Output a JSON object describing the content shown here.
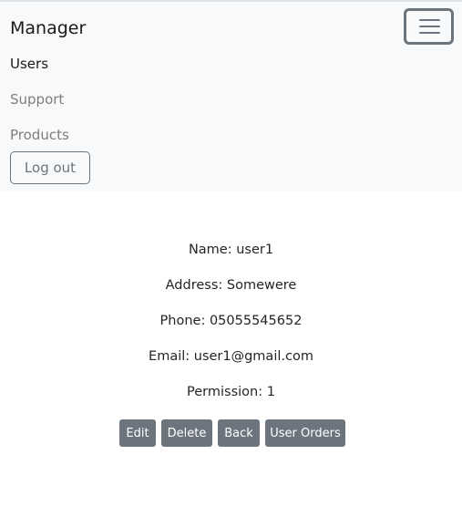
{
  "navbar": {
    "brand": "Manager",
    "items": [
      {
        "label": "Users",
        "active": true
      },
      {
        "label": "Support",
        "active": false
      },
      {
        "label": "Products",
        "active": false
      }
    ],
    "logout_label": "Log out",
    "toggler_icon": "hamburger-icon"
  },
  "user": {
    "name": "Name: user1",
    "address": "Address: Somewere",
    "phone": "Phone: 05055545652",
    "email": "Email: user1@gmail.com",
    "permission": "Permission: 1"
  },
  "actions": {
    "edit": "Edit",
    "delete": "Delete",
    "back": "Back",
    "orders": "User Orders"
  },
  "colors": {
    "navbar_bg": "#f8f9fa",
    "secondary": "#6c757d"
  }
}
